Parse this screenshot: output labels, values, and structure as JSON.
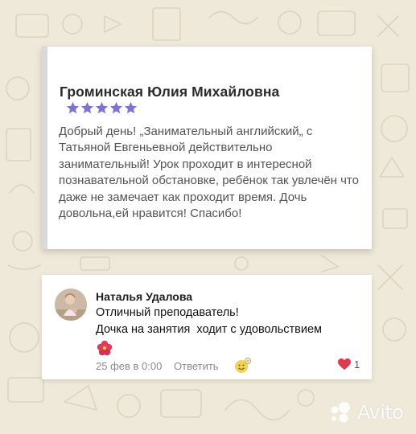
{
  "review_card": {
    "author": "Громинская Юлия Михайловна",
    "rating": 5,
    "star_color": "#7b75cf",
    "text": "Добрый день! „Занимательный английский„ с Татьяной Евгеньевной действительно занимательный! Урок проходит в интересной познавательной обстановке, ребёнок так увлечён что даже не замечает как проходит время. Дочь довольна,ей нравится! Спасибо!"
  },
  "comment_card": {
    "author": "Наталья Удалова",
    "line1": "Отличный преподаватель!",
    "line2": "Дочка на занятия  ходит с удовольствием",
    "date": "25 фев в 0:00",
    "reply_label": "Ответить",
    "like_count": "1",
    "like_color": "#e0384f"
  },
  "watermark": {
    "text": "Avito"
  }
}
